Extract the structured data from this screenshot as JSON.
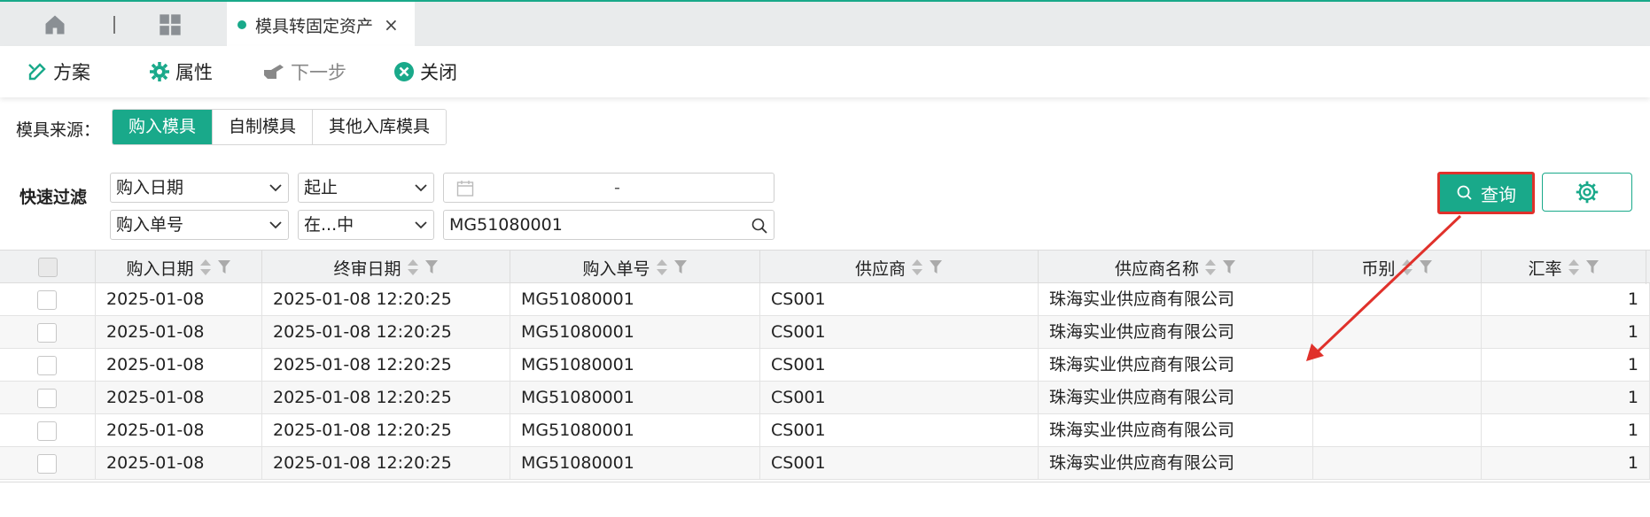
{
  "tabs": {
    "active_tab_label": "模具转固定资产",
    "close_glyph": "×"
  },
  "toolbar": {
    "plan": "方案",
    "props": "属性",
    "next": "下一步",
    "close": "关闭"
  },
  "source": {
    "label": "模具来源：",
    "options": [
      "购入模具",
      "自制模具",
      "其他入库模具"
    ],
    "active": "购入模具"
  },
  "filter": {
    "label": "快速过滤",
    "row1": {
      "field": "购入日期",
      "op": "起止",
      "range_sep": "-"
    },
    "row2": {
      "field": "购入单号",
      "op": "在...中",
      "value": "MG51080001"
    },
    "query_label": "查询"
  },
  "table": {
    "columns": [
      "购入日期",
      "终审日期",
      "购入单号",
      "供应商",
      "供应商名称",
      "币别",
      "汇率"
    ],
    "rows": [
      [
        "2025-01-08",
        "2025-01-08 12:20:25",
        "MG51080001",
        "CS001",
        "珠海实业供应商有限公司",
        "",
        "1"
      ],
      [
        "2025-01-08",
        "2025-01-08 12:20:25",
        "MG51080001",
        "CS001",
        "珠海实业供应商有限公司",
        "",
        "1"
      ],
      [
        "2025-01-08",
        "2025-01-08 12:20:25",
        "MG51080001",
        "CS001",
        "珠海实业供应商有限公司",
        "",
        "1"
      ],
      [
        "2025-01-08",
        "2025-01-08 12:20:25",
        "MG51080001",
        "CS001",
        "珠海实业供应商有限公司",
        "",
        "1"
      ],
      [
        "2025-01-08",
        "2025-01-08 12:20:25",
        "MG51080001",
        "CS001",
        "珠海实业供应商有限公司",
        "",
        "1"
      ],
      [
        "2025-01-08",
        "2025-01-08 12:20:25",
        "MG51080001",
        "CS001",
        "珠海实业供应商有限公司",
        "",
        "1"
      ]
    ]
  },
  "colors": {
    "accent": "#19a98a",
    "highlight": "#e0312b"
  },
  "icons": [
    "home-icon",
    "grid-icon",
    "plan-icon",
    "gear-icon",
    "pointer-icon",
    "close-circle-icon",
    "calendar-icon",
    "search-icon",
    "chevron-down-icon",
    "sort-icon",
    "filter-icon"
  ]
}
